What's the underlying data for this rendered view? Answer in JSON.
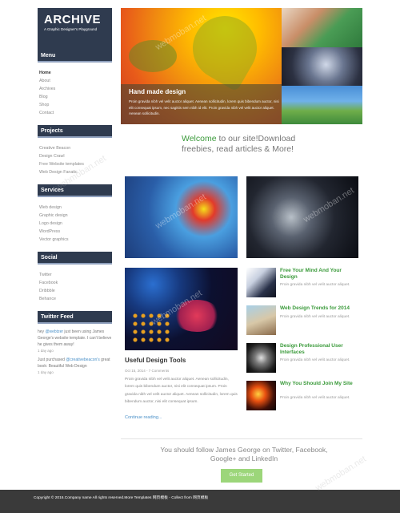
{
  "logo": {
    "title": "ARCHIVE",
    "subtitle": "A Graphic Designer's Playground"
  },
  "sidebar": {
    "menu": {
      "heading": "Menu",
      "items": [
        "Home",
        "About",
        "Archives",
        "Blog",
        "Shop",
        "Contact"
      ]
    },
    "projects": {
      "heading": "Projects",
      "items": [
        "Creative Beacon",
        "Design Crawl",
        "Free Website templates",
        "Web Design Fanatic"
      ]
    },
    "services": {
      "heading": "Services",
      "items": [
        "Web design",
        "Graphic design",
        "Logo design",
        "WordPress",
        "Vector graphics"
      ]
    },
    "social": {
      "heading": "Social",
      "items": [
        "Twitter",
        "Facebook",
        "Dribbble",
        "Behance"
      ]
    },
    "twitter": {
      "heading": "Twitter Feed",
      "tweet1_handle": "@webtzer",
      "tweet1_text": " just been using James George's website template. I can't believe he gives them away!",
      "tweet1_time": "1 day ago",
      "tweet2_text": "Just purchased ",
      "tweet2_handle": "@creativebeacon's",
      "tweet2_text_end": " great book: Beautiful Web Design",
      "tweet2_time": "1 day ago"
    }
  },
  "hero": {
    "title": "Hand made design",
    "text": "Proin gravida nibh vel velit auctor aliquet. Aenean sollicitudin, lorem quis bibendum auctor, nisi elit consequat ipsum, nec sagittis sem nibh id elit. Proin gravida nibh vel velit auctor aliquet. Aenean sollicitudin."
  },
  "welcome": {
    "highlight": "Welcome",
    "text": " to our site!Download freebies, read articles & More!"
  },
  "article": {
    "title": "Useful Design Tools",
    "meta": "Oct 15, 2014 - 7 Comments",
    "body": "Proin gravida nibh vel velit auctor aliquet. Aenean sollicitudin, lorem quis bibendum auctor, nisi elit consequat ipsum. Proin gravida nibh vel velit auctor aliquet. Aenean sollicitudin, lorem quis bibendum auctor, nisi elit consequat ipsum.",
    "read_more": "Continue reading..."
  },
  "side_posts": [
    {
      "title": "Free Your Mind And Your Design",
      "desc": "Proin gravida nibh vel velit auctor aliquet."
    },
    {
      "title": "Web Design Trends for 2014",
      "desc": "Proin gravida nibh vel velit auctor aliquet."
    },
    {
      "title": "Design Professional User Interfaces",
      "desc": "Proin gravida nibh vel velit auctor aliquet."
    },
    {
      "title": "Why You Should Join My Site",
      "desc": "Proin gravida nibh vel velit auctor aliquet."
    }
  ],
  "follow": {
    "text": "You should follow James George on Twitter, Facebook, Google+ and LinkedIn",
    "button": "Get Started"
  },
  "footer": {
    "text": "Copyright © 2016.Company name All rights reserved.More Templates 网页模板 - Collect from 网页模板"
  },
  "watermark": "webmoban.net",
  "colors": {
    "sidebar_heading": "#2f3b4f",
    "accent_green": "#3a9a3a",
    "link_blue": "#4a90c8",
    "button": "#9cd67a",
    "footer": "#3a3a3a"
  }
}
